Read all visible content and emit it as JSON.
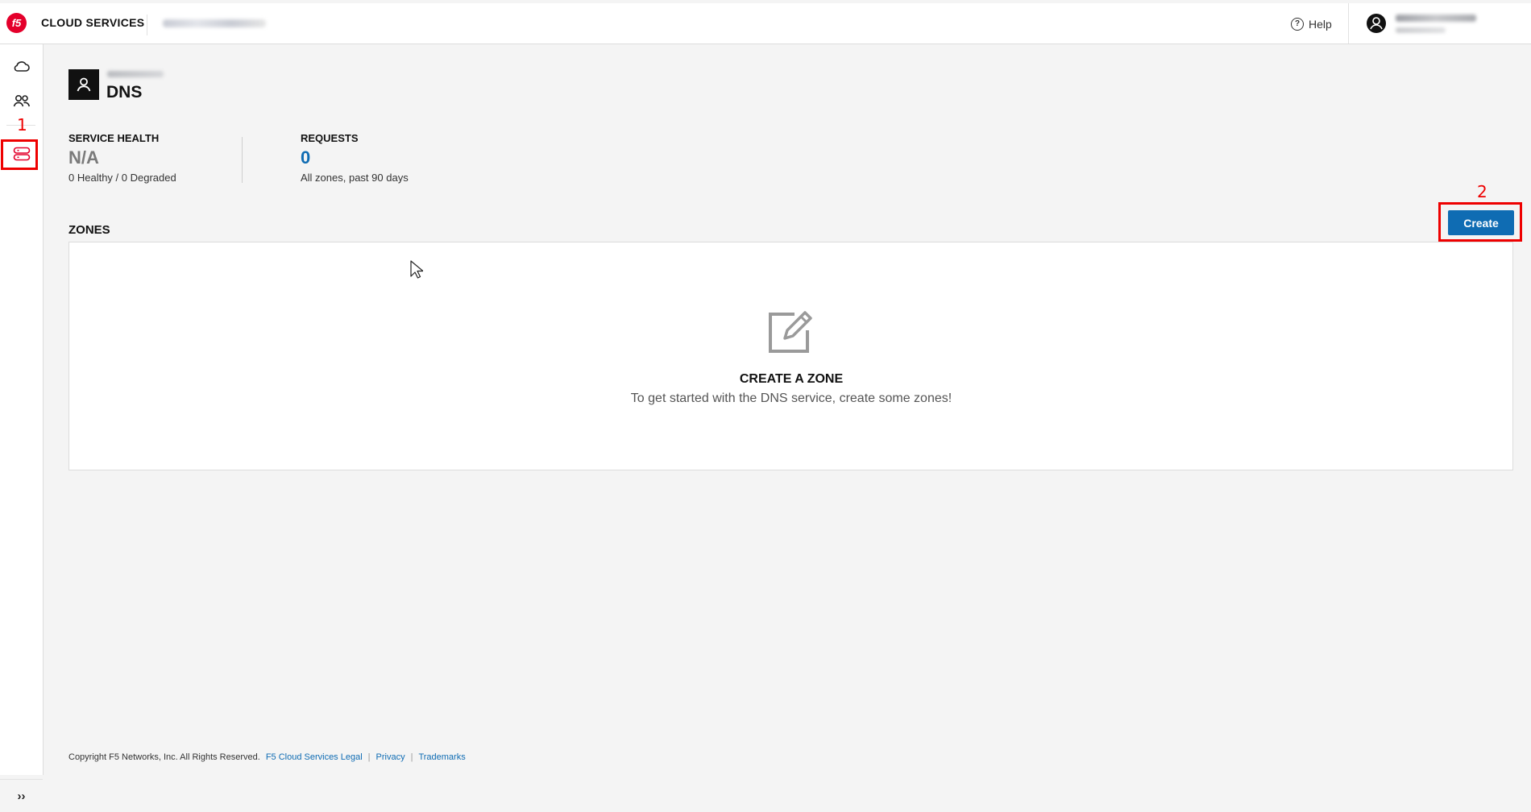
{
  "header": {
    "logo_text": "f5",
    "brand": "CLOUD SERVICES",
    "help_label": "Help",
    "help_icon": "?"
  },
  "sidebar": {
    "items": [
      {
        "icon": "cloud-icon"
      },
      {
        "icon": "users-icon"
      },
      {
        "icon": "dns-servers-icon",
        "active": true
      }
    ],
    "expand_label": "››"
  },
  "annotations": {
    "first": "1",
    "second": "2"
  },
  "service": {
    "title": "DNS"
  },
  "stats": {
    "health_label": "SERVICE HEALTH",
    "health_value": "N/A",
    "health_desc": "0 Healthy / 0 Degraded",
    "requests_label": "REQUESTS",
    "requests_value": "0",
    "requests_desc": "All zones, past 90 days"
  },
  "zones": {
    "label": "ZONES",
    "create_label": "Create",
    "empty_title": "CREATE A ZONE",
    "empty_desc": "To get started with the DNS service, create some zones!"
  },
  "footer": {
    "copyright": "Copyright F5 Networks, Inc. All Rights Reserved.",
    "links": [
      "F5 Cloud Services Legal",
      "Privacy",
      "Trademarks"
    ],
    "separator": "|"
  },
  "colors": {
    "brand_red": "#e4002b",
    "primary_blue": "#0f6cb3",
    "annotation_red": "#e00000"
  }
}
